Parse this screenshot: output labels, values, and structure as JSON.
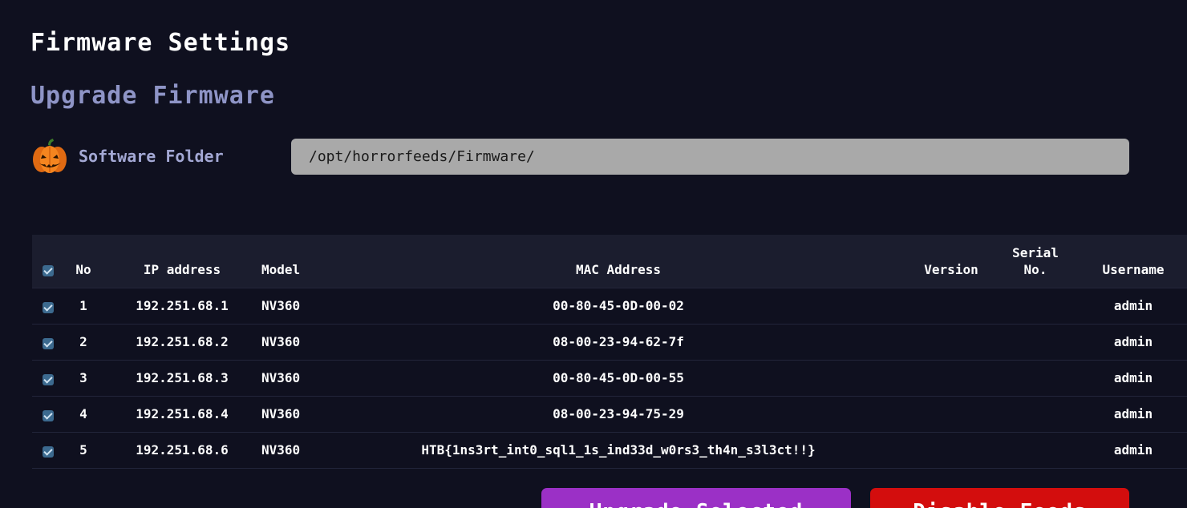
{
  "page": {
    "title": "Firmware Settings",
    "section_title": "Upgrade Firmware"
  },
  "folder": {
    "icon": "pumpkin-icon",
    "label": "Software Folder",
    "value": "/opt/horrorfeeds/Firmware/"
  },
  "table": {
    "headers": {
      "select_all_checked": true,
      "no": "No",
      "ip": "IP address",
      "model": "Model",
      "mac": "MAC Address",
      "version": "Version",
      "serial_line1": "Serial",
      "serial_line2": "No.",
      "username": "Username"
    },
    "rows": [
      {
        "checked": true,
        "no": "1",
        "ip": "192.251.68.1",
        "model": "NV360",
        "mac": "00-80-45-0D-00-02",
        "version": "",
        "serial": "",
        "username": "admin"
      },
      {
        "checked": true,
        "no": "2",
        "ip": "192.251.68.2",
        "model": "NV360",
        "mac": "08-00-23-94-62-7f",
        "version": "",
        "serial": "",
        "username": "admin"
      },
      {
        "checked": true,
        "no": "3",
        "ip": "192.251.68.3",
        "model": "NV360",
        "mac": "00-80-45-0D-00-55",
        "version": "",
        "serial": "",
        "username": "admin"
      },
      {
        "checked": true,
        "no": "4",
        "ip": "192.251.68.4",
        "model": "NV360",
        "mac": "08-00-23-94-75-29",
        "version": "",
        "serial": "",
        "username": "admin"
      },
      {
        "checked": true,
        "no": "5",
        "ip": "192.251.68.6",
        "model": "NV360",
        "mac": "HTB{1ns3rt_int0_sql1_1s_ind33d_w0rs3_th4n_s3l3ct!!}",
        "version": "",
        "serial": "",
        "username": "admin"
      }
    ]
  },
  "buttons": {
    "upgrade_label": "Upgrade Selected",
    "disable_label": "Disable Feeds"
  },
  "colors": {
    "background": "#0f101f",
    "accent_text": "#8e94c6",
    "upgrade_button": "#9b30c6",
    "disable_button": "#d30d0d"
  }
}
